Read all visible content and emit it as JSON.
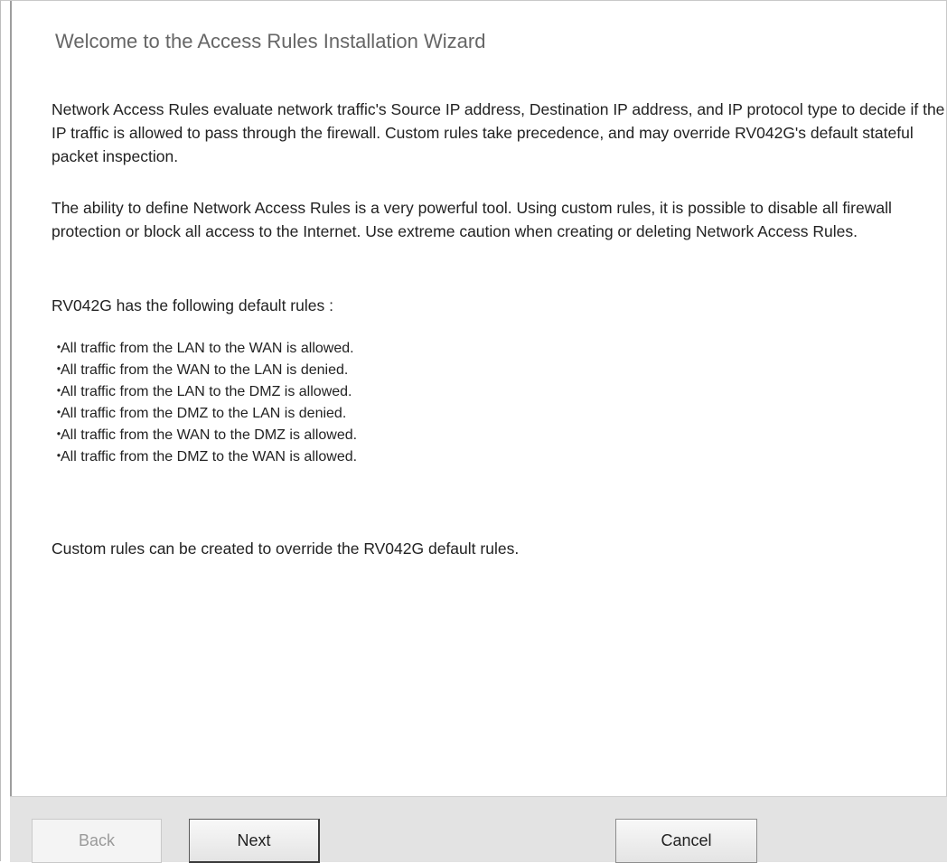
{
  "wizard": {
    "title": "Welcome to the Access Rules Installation Wizard",
    "intro": "Network Access Rules evaluate network traffic's Source IP address, Destination IP address, and IP protocol type to decide if the IP traffic is allowed to pass through the firewall. Custom rules take precedence, and may override RV042G's default stateful packet inspection.",
    "warning": "The ability to define Network Access Rules is a very powerful tool. Using custom rules, it is possible to disable all firewall protection or block all access to the Internet. Use extreme caution when creating or deleting Network Access Rules.",
    "defaults_intro": "RV042G has the following default rules :",
    "bullet": "・",
    "rules": [
      "All traffic from the LAN to the WAN is allowed.",
      "All traffic from the WAN to the LAN is denied.",
      "All traffic from the LAN to the DMZ is allowed.",
      "All traffic from the DMZ to the LAN is denied.",
      "All traffic from the WAN to the DMZ is allowed.",
      "All traffic from the DMZ to the WAN is allowed."
    ],
    "override_note": "Custom rules can be created to override the RV042G default rules."
  },
  "footer": {
    "back_label": "Back",
    "next_label": "Next",
    "cancel_label": "Cancel",
    "back_enabled": false
  }
}
